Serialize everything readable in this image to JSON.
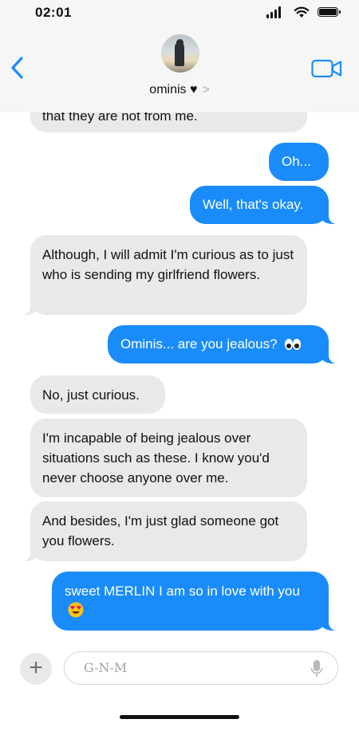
{
  "status_bar": {
    "time": "02:01"
  },
  "header": {
    "back_icon": "chevron-left-icon",
    "contact_name": "ominis ♥",
    "contact_chevron": ">",
    "video_icon": "video-camera-icon"
  },
  "messages": [
    {
      "from": "them",
      "text": "that they are not from me."
    },
    {
      "from": "me",
      "text": "Oh..."
    },
    {
      "from": "me",
      "text": "Well, that's okay."
    },
    {
      "from": "them",
      "text": "Although, I will admit I'm curious as to just who is sending my girlfriend flowers."
    },
    {
      "from": "me",
      "text": "Ominis... are you jealous?",
      "emoji": "eyes"
    },
    {
      "from": "them",
      "text": "No, just curious."
    },
    {
      "from": "them",
      "text": "I'm incapable of being jealous over situations such as these. I know you'd never choose anyone over me."
    },
    {
      "from": "them",
      "text": "And besides, I'm just glad someone got you flowers."
    },
    {
      "from": "me",
      "text": "sweet MERLIN I am so in love with you",
      "emoji": "heart-eyes"
    }
  ],
  "input_bar": {
    "add_icon": "plus-icon",
    "placeholder": "G-N-M",
    "mic_icon": "microphone-icon"
  },
  "colors": {
    "outgoing": "#1a8cf9",
    "incoming": "#e9e9eb",
    "accent": "#1a8cf9",
    "header_bg": "#f6f6f6"
  }
}
